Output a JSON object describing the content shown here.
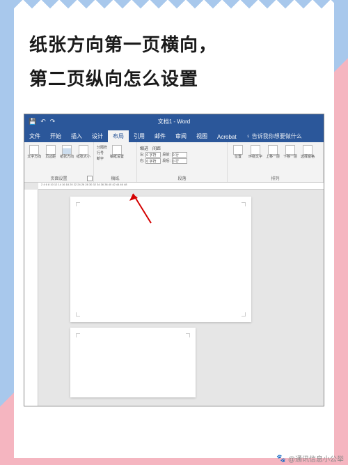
{
  "title_line1": "纸张方向第一页横向，",
  "title_line2": "第二页纵向怎么设置",
  "word": {
    "qat": {
      "save": "💾",
      "undo": "↶",
      "redo": "↷"
    },
    "doc_title": "文档1 - Word",
    "tabs": {
      "file": "文件",
      "home": "开始",
      "insert": "插入",
      "design": "设计",
      "layout": "布局",
      "references": "引用",
      "mailings": "邮件",
      "review": "审阅",
      "view": "视图",
      "acrobat": "Acrobat",
      "tellme": "♀ 告诉我你想要做什么"
    },
    "ribbon": {
      "page_setup": {
        "label": "页面设置",
        "text_direction": "文字方向",
        "margins": "页边距",
        "orientation": "纸张方向",
        "size": "纸张大小"
      },
      "manuscript": {
        "label": "稿纸",
        "breaks": "分隔符",
        "line_numbers": "行号",
        "hyphenation": "断字",
        "settings": "稿纸设置"
      },
      "paragraph": {
        "label": "段落",
        "indent_label": "缩进",
        "spacing_label": "间距",
        "left": "左:",
        "left_val": "0 字符",
        "right": "右:",
        "right_val": "0 字符",
        "before": "段前:",
        "before_val": "0 行",
        "after": "段后:",
        "after_val": "0 行"
      },
      "arrange": {
        "label": "排列",
        "position": "位置",
        "wrap": "环绕文字",
        "forward": "上移一层",
        "backward": "下移一层",
        "pane": "选择窗格"
      }
    },
    "ruler_h": "2  4  6  8  10  12  14  16  18  20  22  24  26  28  30  32  34  36  38  40  42  44  46  48"
  },
  "watermark": {
    "icon": "🐾",
    "text": "@通讯信息小公举"
  }
}
